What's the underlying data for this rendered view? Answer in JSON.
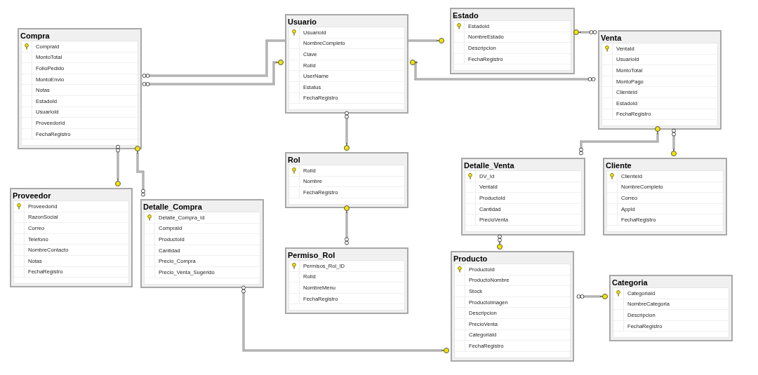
{
  "tables": [
    {
      "name": "Compra",
      "columns": [
        {
          "name": "CompraId",
          "primary_key": true
        },
        {
          "name": "MontoTotal",
          "primary_key": false
        },
        {
          "name": "FolioPedido",
          "primary_key": false
        },
        {
          "name": "MontoEnvio",
          "primary_key": false
        },
        {
          "name": "Notas",
          "primary_key": false
        },
        {
          "name": "EstadoId",
          "primary_key": false
        },
        {
          "name": "UsuarioId",
          "primary_key": false
        },
        {
          "name": "ProveedorId",
          "primary_key": false
        },
        {
          "name": "FechaRegistro",
          "primary_key": false
        }
      ]
    },
    {
      "name": "Usuario",
      "columns": [
        {
          "name": "UsuarioId",
          "primary_key": true
        },
        {
          "name": "NombreCompleto",
          "primary_key": false
        },
        {
          "name": "Clave",
          "primary_key": false
        },
        {
          "name": "RolId",
          "primary_key": false
        },
        {
          "name": "UserName",
          "primary_key": false
        },
        {
          "name": "Estatus",
          "primary_key": false
        },
        {
          "name": "FechaRegistro",
          "primary_key": false
        }
      ]
    },
    {
      "name": "Estado",
      "columns": [
        {
          "name": "EstadoId",
          "primary_key": true
        },
        {
          "name": "NombreEstado",
          "primary_key": false
        },
        {
          "name": "Descripcion",
          "primary_key": false
        },
        {
          "name": "FechaRegistro",
          "primary_key": false
        }
      ]
    },
    {
      "name": "Venta",
      "columns": [
        {
          "name": "VentaId",
          "primary_key": true
        },
        {
          "name": "UsuarioId",
          "primary_key": false
        },
        {
          "name": "MontoTotal",
          "primary_key": false
        },
        {
          "name": "MontoPago",
          "primary_key": false
        },
        {
          "name": "ClienteId",
          "primary_key": false
        },
        {
          "name": "EstadoId",
          "primary_key": false
        },
        {
          "name": "FechaRegistro",
          "primary_key": false
        }
      ]
    },
    {
      "name": "Proveedor",
      "columns": [
        {
          "name": "ProveedorId",
          "primary_key": true
        },
        {
          "name": "RazonSocial",
          "primary_key": false
        },
        {
          "name": "Correo",
          "primary_key": false
        },
        {
          "name": "Telefono",
          "primary_key": false
        },
        {
          "name": "NombreContacto",
          "primary_key": false
        },
        {
          "name": "Notas",
          "primary_key": false
        },
        {
          "name": "FechaRegistro",
          "primary_key": false
        }
      ]
    },
    {
      "name": "Detalle_Compra",
      "columns": [
        {
          "name": "Detalle_Compra_Id",
          "primary_key": true
        },
        {
          "name": "CompraId",
          "primary_key": false
        },
        {
          "name": "ProductoId",
          "primary_key": false
        },
        {
          "name": "Cantidad",
          "primary_key": false
        },
        {
          "name": "Precio_Compra",
          "primary_key": false
        },
        {
          "name": "Precio_Venta_Sugerido",
          "primary_key": false
        }
      ]
    },
    {
      "name": "Rol",
      "columns": [
        {
          "name": "RolId",
          "primary_key": true
        },
        {
          "name": "Nombre",
          "primary_key": false
        },
        {
          "name": "FechaRegistro",
          "primary_key": false
        }
      ]
    },
    {
      "name": "Permiso_Rol",
      "columns": [
        {
          "name": "Permisos_Rol_ID",
          "primary_key": true
        },
        {
          "name": "RolId",
          "primary_key": false
        },
        {
          "name": "NombreMenu",
          "primary_key": false
        },
        {
          "name": "FechaRegistro",
          "primary_key": false
        }
      ]
    },
    {
      "name": "Detalle_Venta",
      "columns": [
        {
          "name": "DV_Id",
          "primary_key": true
        },
        {
          "name": "VentaId",
          "primary_key": false
        },
        {
          "name": "ProductoId",
          "primary_key": false
        },
        {
          "name": "Cantidad",
          "primary_key": false
        },
        {
          "name": "PrecioVenta",
          "primary_key": false
        }
      ]
    },
    {
      "name": "Cliente",
      "columns": [
        {
          "name": "ClienteId",
          "primary_key": true
        },
        {
          "name": "NombreCompleto",
          "primary_key": false
        },
        {
          "name": "Correo",
          "primary_key": false
        },
        {
          "name": "AppId",
          "primary_key": false
        },
        {
          "name": "FechaRegistro",
          "primary_key": false
        }
      ]
    },
    {
      "name": "Producto",
      "columns": [
        {
          "name": "ProductoId",
          "primary_key": true
        },
        {
          "name": "ProductoNombre",
          "primary_key": false
        },
        {
          "name": "Stock",
          "primary_key": false
        },
        {
          "name": "ProductoImagen",
          "primary_key": false
        },
        {
          "name": "Descripcion",
          "primary_key": false
        },
        {
          "name": "PrecioVenta",
          "primary_key": false
        },
        {
          "name": "CategoriaId",
          "primary_key": false
        },
        {
          "name": "FechaRegistro",
          "primary_key": false
        }
      ]
    },
    {
      "name": "Categoria",
      "columns": [
        {
          "name": "CategoriaId",
          "primary_key": true
        },
        {
          "name": "NombreCategoria",
          "primary_key": false
        },
        {
          "name": "Descripcion",
          "primary_key": false
        },
        {
          "name": "FechaRegistro",
          "primary_key": false
        }
      ]
    }
  ]
}
